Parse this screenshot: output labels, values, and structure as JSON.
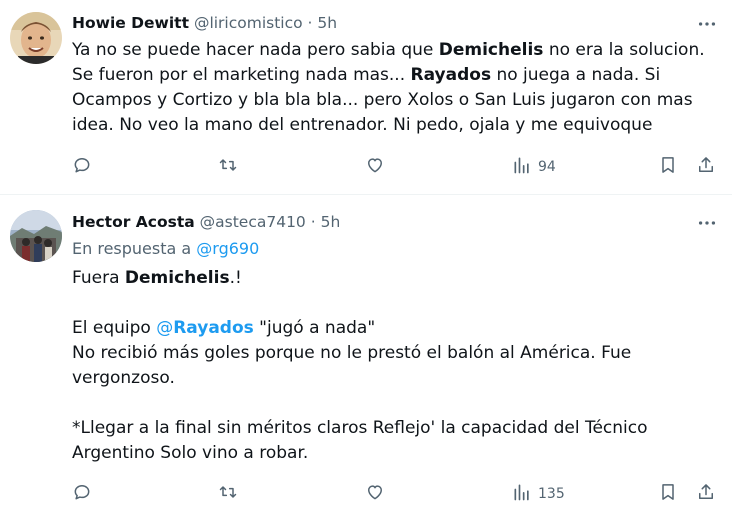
{
  "tweets": [
    {
      "name": "Howie Dewitt",
      "handle": "@liricomistico",
      "dot": "·",
      "time": "5h",
      "lines": [
        [
          {
            "t": "Ya no se puede hacer nada pero sabia que "
          },
          {
            "t": "Demichelis",
            "b": true
          },
          {
            "t": " no era la solucion."
          }
        ],
        [
          {
            "t": "Se fueron por el marketing nada mas... "
          },
          {
            "t": "Rayados",
            "b": true
          },
          {
            "t": " no juega a nada. Si"
          }
        ],
        [
          {
            "t": "Ocampos y Cortizo y bla bla bla... pero Xolos o San Luis jugaron con mas"
          }
        ],
        [
          {
            "t": "idea. No veo la mano del entrenador. Ni pedo, ojala y me equivoque"
          }
        ]
      ],
      "views": "94"
    },
    {
      "name": "Hector Acosta",
      "handle": "@asteca7410",
      "dot": "·",
      "time": "5h",
      "reply_prefix": "En respuesta a",
      "reply_handle": "@rg690",
      "lines": [
        [
          {
            "t": "Fuera "
          },
          {
            "t": "Demichelis",
            "b": true
          },
          {
            "t": ".!"
          }
        ],
        [],
        [
          {
            "t": "El equipo "
          },
          {
            "t": "@",
            "m": true
          },
          {
            "t": "Rayados",
            "m": true,
            "b": true
          },
          {
            "t": "  \"jugó a nada\""
          }
        ],
        [
          {
            "t": "No recibió más goles porque no le prestó el balón al América. Fue"
          }
        ],
        [
          {
            "t": "vergonzoso."
          }
        ],
        [],
        [
          {
            "t": "*Llegar a la final sin méritos claros Reflejo' la capacidad del Técnico"
          }
        ],
        [
          {
            "t": "Argentino Solo vino a robar."
          }
        ]
      ],
      "views": "135"
    }
  ],
  "icons": {
    "reply": "reply-icon",
    "retweet": "retweet-icon",
    "like": "like-icon",
    "views": "views-icon",
    "bookmark": "bookmark-icon",
    "share": "share-icon",
    "more": "more-icon"
  },
  "colors": {
    "text": "#0f1419",
    "secondary": "#536471",
    "mention": "#1d9bf0",
    "divider": "#eff3f4"
  }
}
